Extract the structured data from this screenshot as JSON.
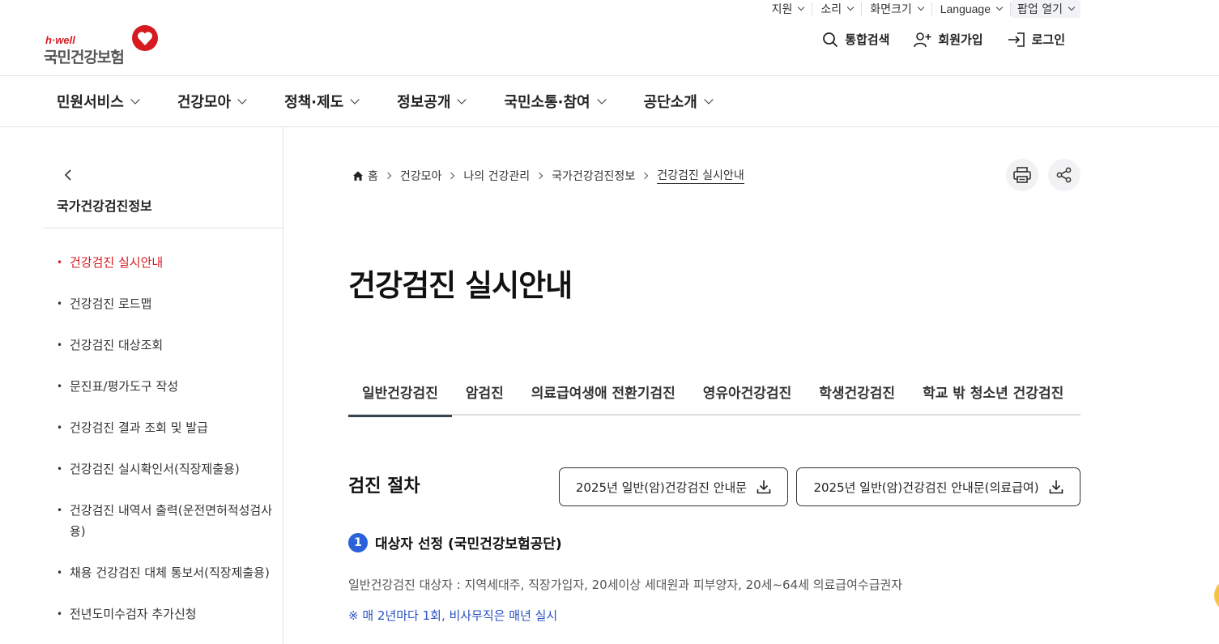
{
  "utility": {
    "support": "지원",
    "sound": "소리",
    "screen_size": "화면크기",
    "language": "Language",
    "popup": "팝업 열기"
  },
  "logo": {
    "tagline": "h·well",
    "name": "국민건강보험"
  },
  "header_actions": {
    "search": "통합검색",
    "join": "회원가입",
    "login": "로그인"
  },
  "gnb": [
    "민원서비스",
    "건강모아",
    "정책·제도",
    "정보공개",
    "국민소통·참여",
    "공단소개"
  ],
  "sidebar": {
    "title": "국가건강검진정보",
    "items": [
      "건강검진 실시안내",
      "건강검진 로드맵",
      "건강검진 대상조회",
      "문진표/평가도구 작성",
      "건강검진 결과 조회 및 발급",
      "건강검진 실시확인서(직장제출용)",
      "건강검진 내역서 출력(운전면허적성검사용)",
      "채용 건강검진 대체 통보서(직장제출용)",
      "전년도미수검자 추가신청"
    ]
  },
  "breadcrumb": [
    "홈",
    "건강모아",
    "나의 건강관리",
    "국가건강검진정보",
    "건강검진 실시안내"
  ],
  "page_title": "건강검진 실시안내",
  "tabs": [
    "일반건강검진",
    "암검진",
    "의료급여생애 전환기검진",
    "영유아건강검진",
    "학생건강검진",
    "학교 밖 청소년 건강검진"
  ],
  "section": {
    "title": "검진 절차",
    "download_1": "2025년 일반(암)건강검진 안내문",
    "download_2": "2025년 일반(암)건강검진 안내문(의료급여)",
    "step_number": "1",
    "step_title": "대상자 선정 (국민건강보험공단)",
    "description": "일반건강검진 대상자 : 지역세대주, 직장가입자, 20세이상 세대원과 피부양자, 20세~64세 의료급여수급권자",
    "note": "※ 매 2년마다 1회, 비사무직은 매년 실시"
  },
  "colors": {
    "brand_red": "#d71920",
    "step_blue": "#2b62d9",
    "note_blue": "#2b53c2",
    "tab_underline": "#3a4456"
  }
}
